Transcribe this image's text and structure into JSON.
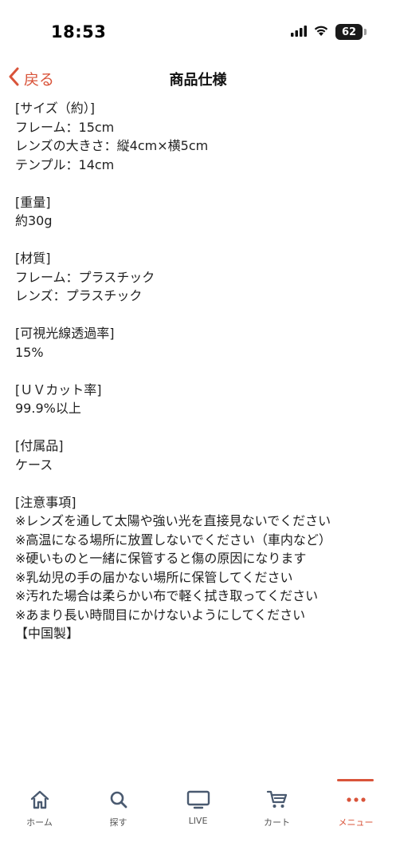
{
  "status_bar": {
    "time": "18:53",
    "battery": "62"
  },
  "header": {
    "back_label": "戻る",
    "title": "商品仕様"
  },
  "spec_sections": [
    {
      "lines": [
        "[サイズ（約）]",
        "フレーム：15cm",
        "レンズの大きさ：縦4cm×横5cm",
        "テンプル：14cm"
      ]
    },
    {
      "lines": [
        "[重量]",
        "約30g"
      ]
    },
    {
      "lines": [
        "[材質]",
        "フレーム：プラスチック",
        "レンズ：プラスチック"
      ]
    },
    {
      "lines": [
        "[可視光線透過率]",
        "15%"
      ]
    },
    {
      "lines": [
        "[ＵＶカット率]",
        "99.9%以上"
      ]
    },
    {
      "lines": [
        "[付属品]",
        "ケース"
      ]
    },
    {
      "lines": [
        "[注意事項]",
        "※レンズを通して太陽や強い光を直接見ないでください",
        "※高温になる場所に放置しないでください（車内など）",
        "※硬いものと一緒に保管すると傷の原因になります",
        "※乳幼児の手の届かない場所に保管してください",
        "※汚れた場合は柔らかい布で軽く拭き取ってください",
        "※あまり長い時間目にかけないようにしてください",
        "【中国製】"
      ]
    }
  ],
  "tab_bar": {
    "accent_color": "#d9543a",
    "items": [
      {
        "label": "ホーム",
        "icon": "home-icon"
      },
      {
        "label": "探す",
        "icon": "search-icon"
      },
      {
        "label": "LIVE",
        "icon": "tv-icon"
      },
      {
        "label": "カート",
        "icon": "cart-icon"
      },
      {
        "label": "メニュー",
        "icon": "more-icon",
        "active": true
      }
    ]
  }
}
